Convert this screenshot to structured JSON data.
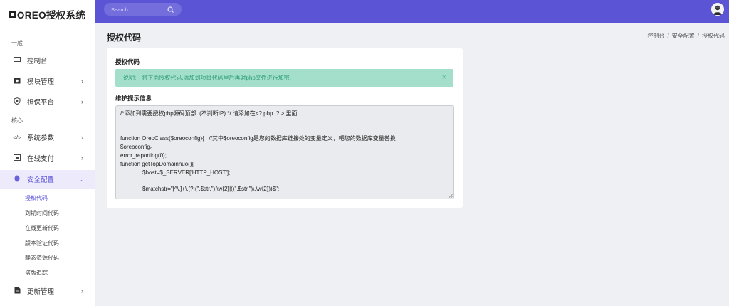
{
  "sidebar": {
    "logo": "OREO授权系统",
    "sections": [
      "一般",
      "核心"
    ],
    "items": [
      {
        "label": "控制台",
        "icon": "monitor-icon"
      },
      {
        "label": "模块管理",
        "icon": "module-icon"
      },
      {
        "label": "担保平台",
        "icon": "shield-icon"
      },
      {
        "label": "系统参数",
        "icon": "code-icon"
      },
      {
        "label": "在线支付",
        "icon": "payment-icon"
      },
      {
        "label": "安全配置",
        "icon": "security-icon"
      },
      {
        "label": "更新管理",
        "icon": "file-icon"
      }
    ],
    "subitems": [
      "授权代码",
      "到期时间代码",
      "在线更新代码",
      "版本验证代码",
      "静态资源代码",
      "盗版追踪"
    ]
  },
  "topbar": {
    "search_placeholder": "Search..."
  },
  "page": {
    "title": "授权代码",
    "breadcrumb": [
      "控制台",
      "安全配置",
      "授权代码"
    ]
  },
  "card": {
    "title": "授权代码",
    "alert_label": "说明:",
    "alert_text": "将下面授权代码,添加到项目代码里后再对php文件进行加密.",
    "alert_close": "×",
    "section_label": "维护提示信息",
    "code_lines": [
      "/*添加到需要授权php源码顶部  (不判断IP) */ 请添加在<? php  ? > 里面",
      "",
      "",
      "function OreoClass($oreoconfig){   //其中$oreoconfig是您的数据库链接处的变量定义，吧您的数据库变量替换",
      "$oreoconfig。",
      "error_reporting(0);",
      "function getTopDomainhuo(){",
      "              $host=$_SERVER['HTTP_HOST'];",
      "",
      "              $matchstr=\"[^\\.]+\\.(?:(\".$str.\")|\\w{2}|((\".$str.\")\\.\\w{2}))$\";"
    ]
  },
  "colors": {
    "topbar": "#5b55d6",
    "accent": "#5b52d6",
    "alert_bg": "#a3dfcb",
    "alert_text": "#2f9d79"
  }
}
